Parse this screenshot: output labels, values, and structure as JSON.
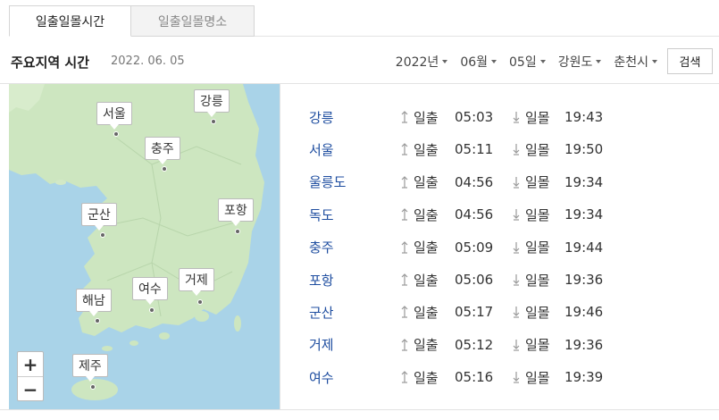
{
  "tabs": [
    {
      "label": "일출일몰시간",
      "active": true
    },
    {
      "label": "일출일몰명소",
      "active": false
    }
  ],
  "toolbar": {
    "title": "주요지역 시간",
    "date": "2022. 06. 05",
    "year": "2022년",
    "month": "06월",
    "day": "05일",
    "province": "강원도",
    "city": "춘천시",
    "search_label": "검색"
  },
  "map": {
    "zoom_in": "+",
    "zoom_out": "−",
    "labels": [
      {
        "name": "서울"
      },
      {
        "name": "강릉"
      },
      {
        "name": "충주"
      },
      {
        "name": "군산"
      },
      {
        "name": "포항"
      },
      {
        "name": "여수"
      },
      {
        "name": "거제"
      },
      {
        "name": "해남"
      },
      {
        "name": "제주"
      }
    ]
  },
  "list": {
    "rise_label": "일출",
    "set_label": "일몰",
    "rows": [
      {
        "city": "강릉",
        "rise": "05:03",
        "set": "19:43"
      },
      {
        "city": "서울",
        "rise": "05:11",
        "set": "19:50"
      },
      {
        "city": "울릉도",
        "rise": "04:56",
        "set": "19:34"
      },
      {
        "city": "독도",
        "rise": "04:56",
        "set": "19:34"
      },
      {
        "city": "충주",
        "rise": "05:09",
        "set": "19:44"
      },
      {
        "city": "포항",
        "rise": "05:06",
        "set": "19:36"
      },
      {
        "city": "군산",
        "rise": "05:17",
        "set": "19:46"
      },
      {
        "city": "거제",
        "rise": "05:12",
        "set": "19:36"
      },
      {
        "city": "여수",
        "rise": "05:16",
        "set": "19:39"
      }
    ]
  },
  "colors": {
    "sea": "#a9d3e8",
    "land": "#cde6c0",
    "city_link": "#1f4ea0"
  }
}
